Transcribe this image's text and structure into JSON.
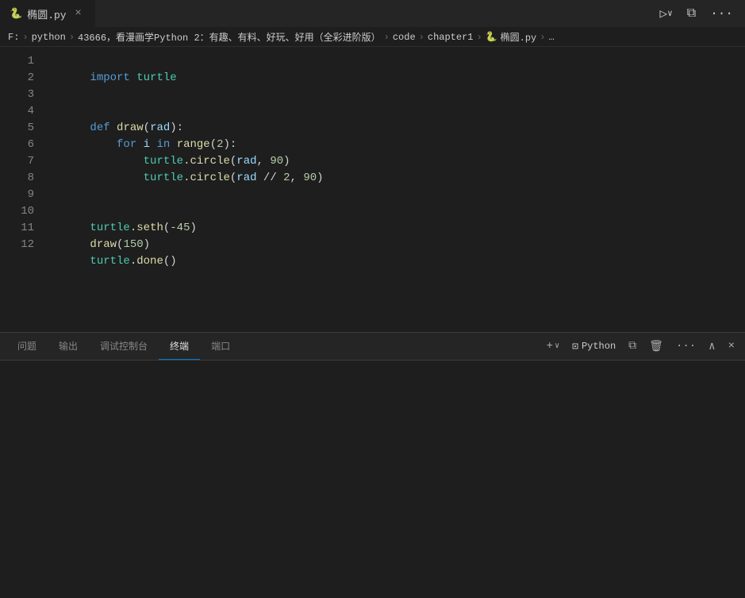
{
  "tab": {
    "icon": "🐍",
    "label": "椭圆.py",
    "close_icon": "×"
  },
  "toolbar": {
    "run_icon": "▷",
    "run_dropdown": "∨",
    "split_icon": "⧉",
    "more_icon": "···"
  },
  "breadcrumb": {
    "items": [
      "F:",
      "python",
      "43666，看漫画学Python 2：有趣、有料、好玩、好用（全彩进阶版）",
      "code",
      "chapter1",
      "椭圆.py",
      "…"
    ]
  },
  "code": {
    "lines": [
      {
        "num": 1,
        "text": "import turtle"
      },
      {
        "num": 2,
        "text": ""
      },
      {
        "num": 3,
        "text": ""
      },
      {
        "num": 4,
        "text": "def draw(rad):"
      },
      {
        "num": 5,
        "text": "    for i in range(2):"
      },
      {
        "num": 6,
        "text": "        turtle.circle(rad, 90)"
      },
      {
        "num": 7,
        "text": "        turtle.circle(rad // 2, 90)"
      },
      {
        "num": 8,
        "text": ""
      },
      {
        "num": 9,
        "text": ""
      },
      {
        "num": 10,
        "text": "turtle.seth(-45)"
      },
      {
        "num": 11,
        "text": "draw(150)"
      },
      {
        "num": 12,
        "text": "turtle.done()"
      }
    ]
  },
  "panel": {
    "tabs": [
      "问题",
      "输出",
      "调试控制台",
      "终端",
      "端口"
    ],
    "active_tab": "终端",
    "add_label": "+",
    "python_label": "Python",
    "trash_icon": "🗑",
    "more_icon": "···",
    "up_icon": "∧",
    "close_icon": "×"
  }
}
